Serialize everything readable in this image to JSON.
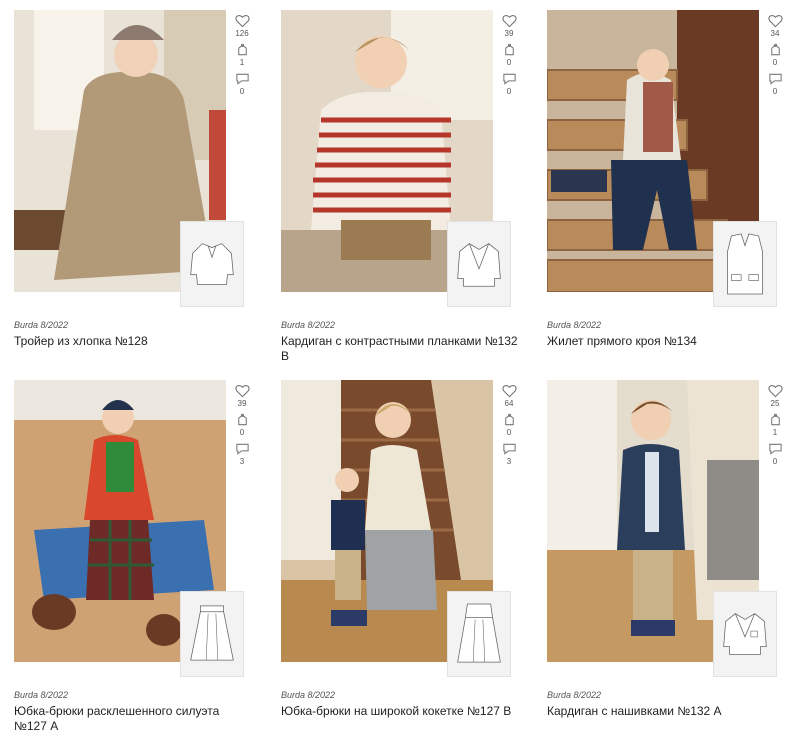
{
  "colors": {
    "icon": "#777777",
    "text": "#222222",
    "source": "#555555",
    "sketch_bg": "#f3f3f3"
  },
  "icons": {
    "like": "heart-icon",
    "save": "hanger-icon",
    "comment": "comment-icon"
  },
  "cards": [
    {
      "source": "Burda 8/2022",
      "title": "Тройер из хлопка №128",
      "likes": "126",
      "saves": "1",
      "comments": "0"
    },
    {
      "source": "Burda 8/2022",
      "title": "Кардиган с контрастными планками №132 B",
      "likes": "39",
      "saves": "0",
      "comments": "0"
    },
    {
      "source": "Burda 8/2022",
      "title": "Жилет прямого кроя №134",
      "likes": "34",
      "saves": "0",
      "comments": "0"
    },
    {
      "source": "Burda 8/2022",
      "title": "Юбка-брюки расклешенного силуэта №127 A",
      "likes": "39",
      "saves": "0",
      "comments": "3"
    },
    {
      "source": "Burda 8/2022",
      "title": "Юбка-брюки на широкой кокетке №127 B",
      "likes": "64",
      "saves": "0",
      "comments": "3"
    },
    {
      "source": "Burda 8/2022",
      "title": "Кардиган с нашивками №132 A",
      "likes": "25",
      "saves": "1",
      "comments": "0"
    }
  ]
}
